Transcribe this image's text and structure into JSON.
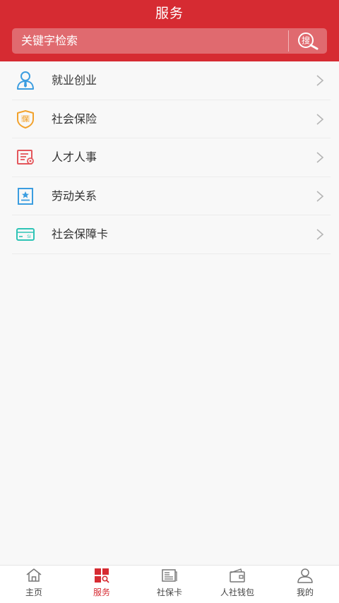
{
  "header": {
    "title": "服务",
    "search_placeholder": "关键字检索",
    "search_button_glyph": "搜"
  },
  "list": {
    "items": [
      {
        "label": "就业创业",
        "icon": "person-tie-icon",
        "color": "#3b9de0"
      },
      {
        "label": "社会保险",
        "icon": "insurance-shield-icon",
        "color": "#f2a22c"
      },
      {
        "label": "人才人事",
        "icon": "certificate-icon",
        "color": "#e4575c"
      },
      {
        "label": "劳动关系",
        "icon": "star-document-icon",
        "color": "#3b9de0"
      },
      {
        "label": "社会保障卡",
        "icon": "si-card-icon",
        "color": "#2ec4b6",
        "card_text": "SI"
      }
    ]
  },
  "tabbar": {
    "tabs": [
      {
        "label": "主页",
        "icon": "home-icon",
        "active": false
      },
      {
        "label": "服务",
        "icon": "service-grid-icon",
        "active": true
      },
      {
        "label": "社保卡",
        "icon": "card-icon",
        "active": false
      },
      {
        "label": "人社钱包",
        "icon": "wallet-icon",
        "active": false
      },
      {
        "label": "我的",
        "icon": "user-icon",
        "active": false
      }
    ]
  },
  "colors": {
    "brand": "#d62b32",
    "text": "#333333",
    "background": "#f8f8f8"
  }
}
